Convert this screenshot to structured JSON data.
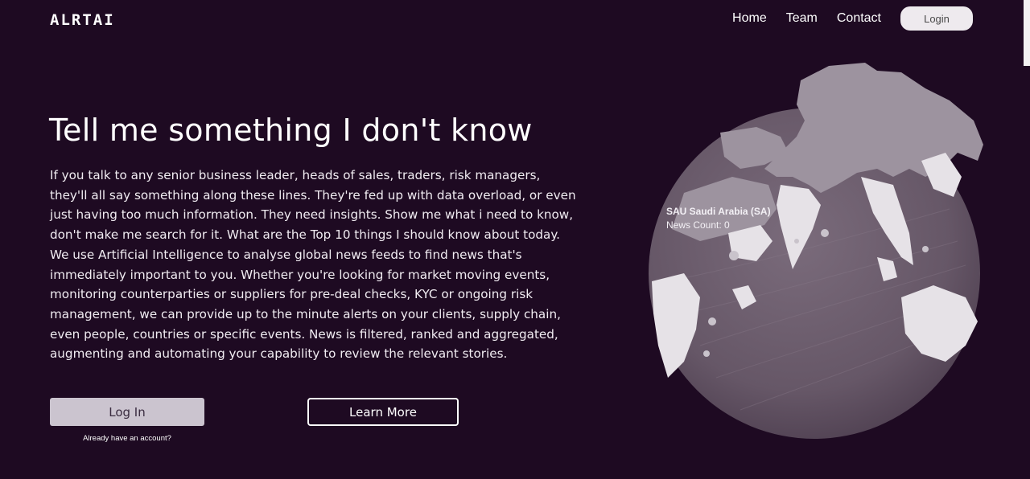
{
  "header": {
    "logo": "ALRTAI",
    "nav": [
      {
        "label": "Home"
      },
      {
        "label": "Team"
      },
      {
        "label": "Contact"
      }
    ],
    "login_label": "Login"
  },
  "hero": {
    "headline": "Tell me something I don't know",
    "body": "If you talk to any senior business leader, heads of sales, traders, risk managers, they'll all say something along these lines. They're fed up with data overload, or even just having too much information. They need insights. Show me what i need to know, don't make me search for it. What are the Top 10 things I should know about today. We use Artificial Intelligence to analyse global news feeds to find news that's immediately important to you. Whether you're looking for market moving events, monitoring counterparties or suppliers for pre-deal checks, KYC or ongoing risk management, we can provide up to the minute alerts on your clients, supply chain, even people, countries or specific events. News is filtered, ranked and aggregated, augmenting and automating your capability to review the relevant stories.",
    "login_button": "Log In",
    "login_hint": "Already have an account?",
    "learn_more": "Learn More"
  },
  "globe": {
    "tooltip_country": "SAU Saudi Arabia (SA)",
    "tooltip_count": "News Count: 0"
  },
  "colors": {
    "background": "#1e0a22",
    "globe_ocean": "#6f6170",
    "globe_land": "#e9e6ea",
    "login_button_bg": "#cbc4cf"
  }
}
